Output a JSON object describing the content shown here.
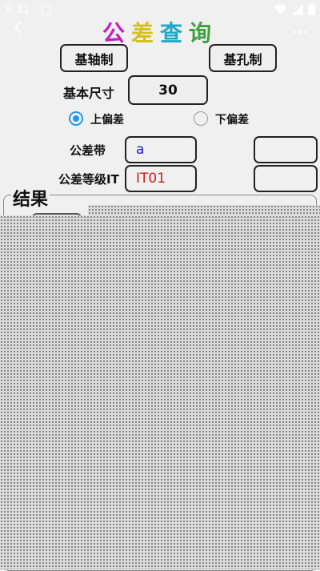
{
  "status": {
    "time": "9:31"
  },
  "title": {
    "chars": [
      "公",
      "差",
      "查",
      "询"
    ],
    "colors": [
      "#c020c0",
      "#d4c020",
      "#20a8c8",
      "#40a040"
    ]
  },
  "buttons": {
    "shaft_basis": "基轴制",
    "hole_basis": "基孔制"
  },
  "basic_size": {
    "label": "基本尺寸",
    "value": "30"
  },
  "deviation": {
    "upper_label": "上偏差",
    "lower_label": "下偏差",
    "selected": "upper"
  },
  "tolerance_zone": {
    "label": "公差带",
    "value": "a",
    "value_color": "#1a1acc",
    "second_value": ""
  },
  "tolerance_grade": {
    "label": "公差等级IT",
    "value": "IT01",
    "value_color": "#cc2020",
    "second_value": ""
  },
  "result": {
    "title": "结果"
  }
}
